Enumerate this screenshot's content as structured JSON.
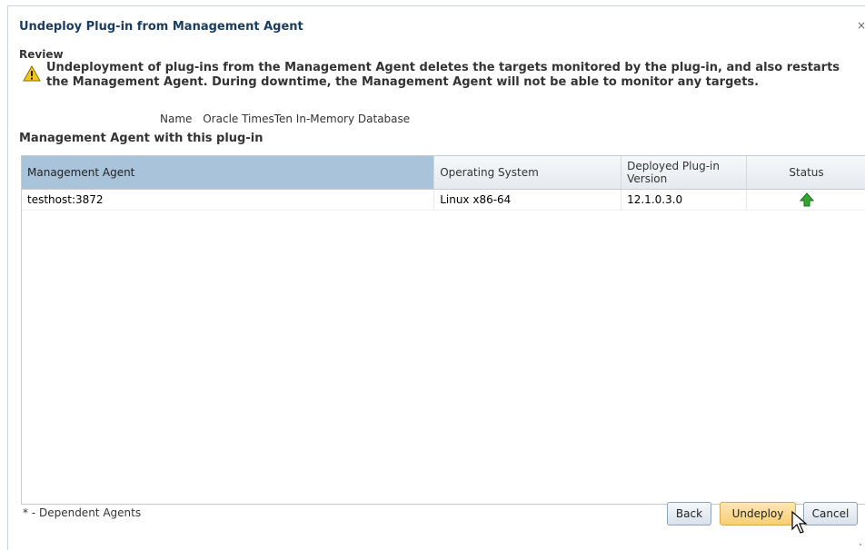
{
  "dialog": {
    "title": "Undeploy Plug-in from Management Agent",
    "close_glyph": "×"
  },
  "review": {
    "label": "Review",
    "warning_icon": "warning-triangle-icon",
    "warning_text": "Undeployment of plug-ins from the Management Agent deletes the targets monitored by the plug-in, and also restarts the Management Agent. During downtime, the Management Agent will not be able to monitor any targets."
  },
  "plugin": {
    "name_label": "Name",
    "name_value": "Oracle TimesTen In-Memory Database"
  },
  "agents_section": {
    "title": "Management Agent with this plug-in",
    "columns": [
      "Management Agent",
      "Operating System",
      "Deployed Plug-in Version",
      "Status"
    ],
    "rows": [
      {
        "agent": "testhost:3872",
        "os": "Linux x86-64",
        "version": "12.1.0.3.0",
        "status_icon": "up-arrow-green-icon"
      }
    ]
  },
  "footer": {
    "footnote": "* - Dependent Agents",
    "back_label": "Back",
    "undeploy_label": "Undeploy",
    "cancel_label": "Cancel"
  },
  "colors": {
    "title": "#1a3d62",
    "selected_header": "#a9c3db",
    "primary_button": "#f7cf73",
    "status_green": "#2fa82f"
  }
}
